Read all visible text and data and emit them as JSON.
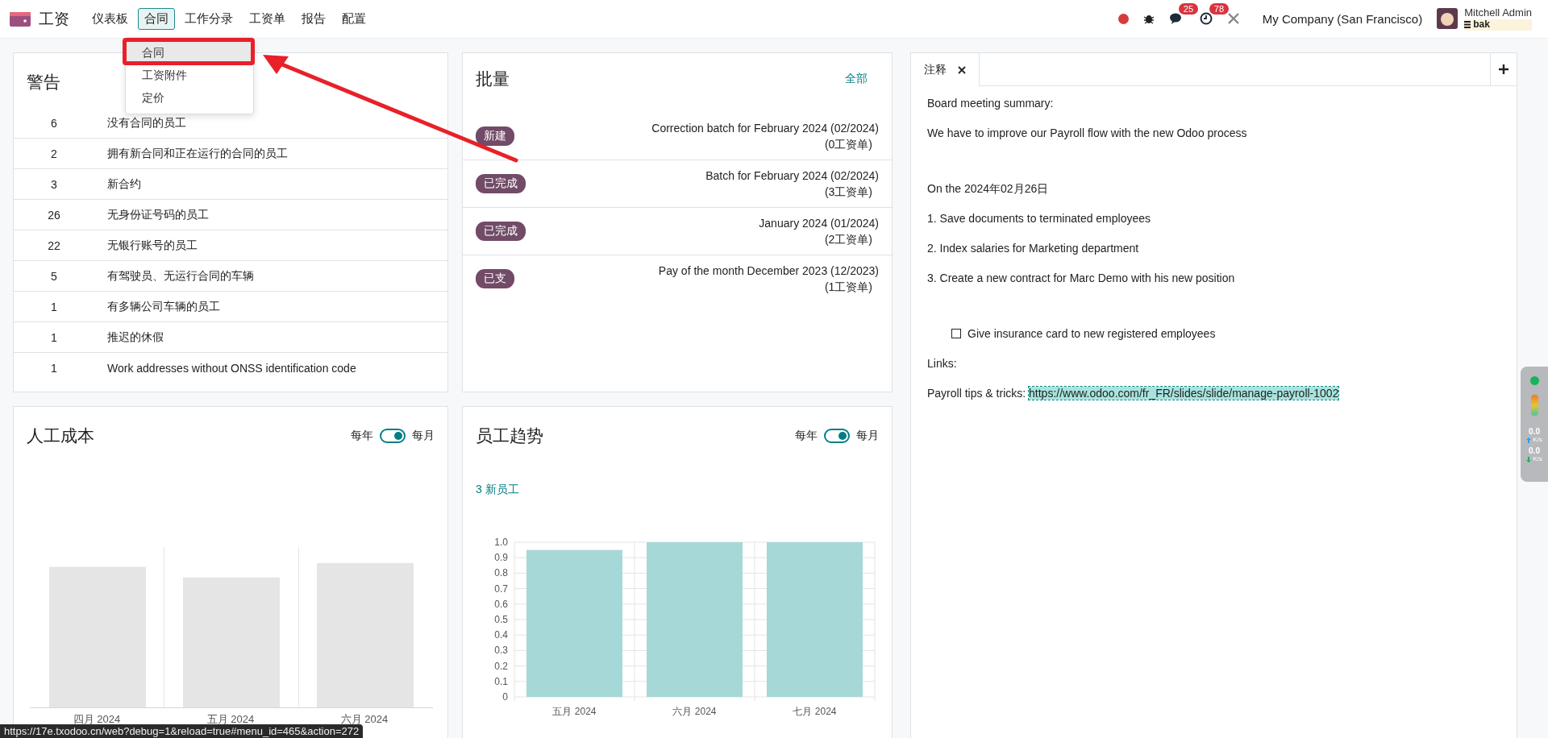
{
  "app": {
    "name": "工资"
  },
  "menu": [
    {
      "label": "仪表板",
      "selected": false
    },
    {
      "label": "合同",
      "selected": true
    },
    {
      "label": "工作分录",
      "selected": false
    },
    {
      "label": "工资单",
      "selected": false
    },
    {
      "label": "报告",
      "selected": false
    },
    {
      "label": "配置",
      "selected": false
    }
  ],
  "dropdown": {
    "items": [
      {
        "label": "合同",
        "selected": true
      },
      {
        "label": "工资附件",
        "selected": false
      },
      {
        "label": "定价",
        "selected": false
      }
    ]
  },
  "systray": {
    "chat_count": "25",
    "activity_count": "78",
    "company": "My Company (San Francisco)",
    "user": "Mitchell Admin",
    "database": "bak"
  },
  "warnings": {
    "title": "警告",
    "rows": [
      {
        "count": "6",
        "label": "没有合同的员工"
      },
      {
        "count": "2",
        "label": "拥有新合同和正在运行的合同的员工"
      },
      {
        "count": "3",
        "label": "新合约"
      },
      {
        "count": "26",
        "label": "无身份证号码的员工"
      },
      {
        "count": "22",
        "label": "无银行账号的员工"
      },
      {
        "count": "5",
        "label": "有驾驶员、无运行合同的车辆"
      },
      {
        "count": "1",
        "label": "有多辆公司车辆的员工"
      },
      {
        "count": "1",
        "label": "推迟的休假"
      },
      {
        "count": "1",
        "label": "Work addresses without ONSS identification code"
      }
    ]
  },
  "batches": {
    "title": "批量",
    "link": "全部",
    "rows": [
      {
        "status": "新建",
        "name": "Correction batch for February 2024 (02/2024)",
        "payslips": "(0工资单)"
      },
      {
        "status": "已完成",
        "name": "Batch for February 2024 (02/2024)",
        "payslips": "(3工资单)"
      },
      {
        "status": "已完成",
        "name": "January 2024 (01/2024)",
        "payslips": "(2工资单)"
      },
      {
        "status": "已支",
        "name": "Pay of the month December 2023 (12/2023)",
        "payslips": "(1工资单)"
      }
    ]
  },
  "labor_cost": {
    "title": "人工成本",
    "toggle": {
      "left": "每年",
      "right": "每月",
      "on": true
    },
    "x_labels": [
      "四月 2024",
      "五月 2024",
      "六月 2024"
    ]
  },
  "employee_trend": {
    "title": "员工趋势",
    "toggle": {
      "left": "每年",
      "right": "每月",
      "on": true
    },
    "link": "3 新员工",
    "chart_data": {
      "type": "bar",
      "grid": true,
      "categories": [
        "五月 2024",
        "六月 2024",
        "七月 2024"
      ],
      "values": [
        0.95,
        1.0,
        1.0
      ],
      "ylim": [
        0,
        1
      ],
      "yticks": [
        0,
        0.1,
        0.2,
        0.3,
        0.4,
        0.5,
        0.6,
        0.7,
        0.8,
        0.9,
        {
          "value": 1,
          "label": "1.0"
        }
      ]
    }
  },
  "notes": {
    "tab": "注释",
    "sections": [
      [
        {
          "kind": "text",
          "text": "Board meeting summary:"
        },
        {
          "kind": "text",
          "text": "We have to improve our Payroll flow with the new Odoo process"
        }
      ],
      [
        {
          "kind": "text",
          "text": "On the 2024年02月26日"
        },
        {
          "kind": "text",
          "text": "1. Save documents to terminated employees"
        },
        {
          "kind": "text",
          "text": "2. Index salaries for Marketing department"
        },
        {
          "kind": "text",
          "text": "3. Create a new contract for Marc Demo with his new position"
        }
      ],
      [
        {
          "kind": "check",
          "text": "Give insurance card to new registered employees",
          "checked": false
        },
        {
          "kind": "text",
          "text": "Links:"
        },
        {
          "kind": "link",
          "text": "Payroll tips & tricks:",
          "url": "https://www.odoo.com/fr_FR/slides/slide/manage-payroll-1002"
        }
      ]
    ]
  },
  "speed_widget": {
    "upload": "0.0",
    "upload_unit": "K/s",
    "download": "0.0",
    "download_unit": "K/s"
  },
  "status_url": "https://17e.txodoo.cn/web?debug=1&reload=true#menu_id=465&action=272"
}
